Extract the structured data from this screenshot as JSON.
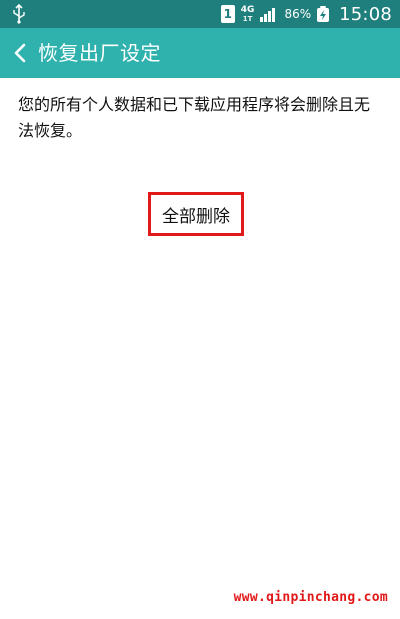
{
  "status_bar": {
    "sim_slot": "1",
    "network_type": "4G",
    "network_sub": "1T",
    "battery_percent": "86%",
    "time": "15:08",
    "usb_icon": "usb-icon",
    "signal_icon": "signal-bars-icon",
    "battery_icon": "battery-charging-icon"
  },
  "header": {
    "back_icon": "chevron-left-icon",
    "title": "恢复出厂设定"
  },
  "main": {
    "description": "您的所有个人数据和已下载应用程序将会删除且无法恢复。",
    "delete_all_label": "全部删除"
  },
  "watermark": {
    "text": "www.qinpinchang.com"
  },
  "colors": {
    "status_bar": "#1f7f7c",
    "title_bar": "#2fb1ad",
    "highlight": "#e11919"
  }
}
